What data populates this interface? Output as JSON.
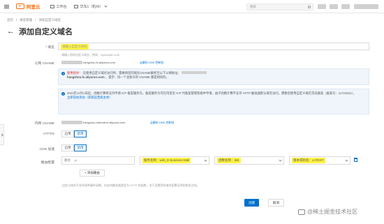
{
  "header": {
    "brand": "阿里云",
    "workbench": "工作台",
    "region": "华东1（杭州）",
    "search_placeholder": "搜索"
  },
  "breadcrumb": [
    "首页",
    "/",
    "域名管理",
    "/",
    "添加自定义域名"
  ],
  "page_title": "添加自定义域名",
  "domain": {
    "label": "* 域名",
    "placeholder": "请输入自定义域名",
    "help": "请输入您的自定义域名，例如：mydomain.com"
  },
  "public_cname": {
    "label": "公网 CNAME",
    "value_suffix": "hangzhou.fc.aliyuncs.com",
    "link": "云解析 DNS 控制台"
  },
  "notice1": {
    "title": "使用指导：",
    "text": "在使用自定义域名访问时，需要将您的域名CNAME解析至以下公网地址：",
    "bold": "hangzhou.fc.aliyuncs.com",
    "tail": "，提示：同一个主账号的 CNAME 都是相同的。"
  },
  "notice2": {
    "text": "2021年12月1日起，函数计算将支持申请 ICP 备案服务号。备案服务号可在阿里云 ICP 代备案管理系统中申请，由于函数计算不支持 HTTP 触发器默认域名访问，需要您使用自定义域名完成备案（备案号：11721531）。",
    "link": "立即前往添加（获取运营商主体）"
  },
  "internal_cname": {
    "label": "内网 CNAME",
    "value_suffix": "hangzhou-internal.fc.aliyuncs.com",
    "link": "云解析 DNS 控制台"
  },
  "https": {
    "label": "HTTPS",
    "on": "启用",
    "off": "禁用"
  },
  "cdn": {
    "label": "CDN 加速",
    "on": "启用",
    "off": "禁用"
  },
  "route": {
    "label": "路由配置",
    "path_label": "路径",
    "path_value": "/*",
    "service_label": "服务名称",
    "service_value": "web_E-business-Mall",
    "function_label": "函数名称",
    "function_value": "dist",
    "version_label": "版本或别名",
    "version_value": "LATEST",
    "add_button": "+ 添加路由"
  },
  "bottom_note": "自定义域名不支持多种事件函数，仅支持触发器类型为 HTTP 的函数，关于设置您的域名配置证明的相关文档。",
  "buttons": {
    "create": "创建",
    "cancel": "取消"
  },
  "watermark": "@稀土掘金技术社区"
}
